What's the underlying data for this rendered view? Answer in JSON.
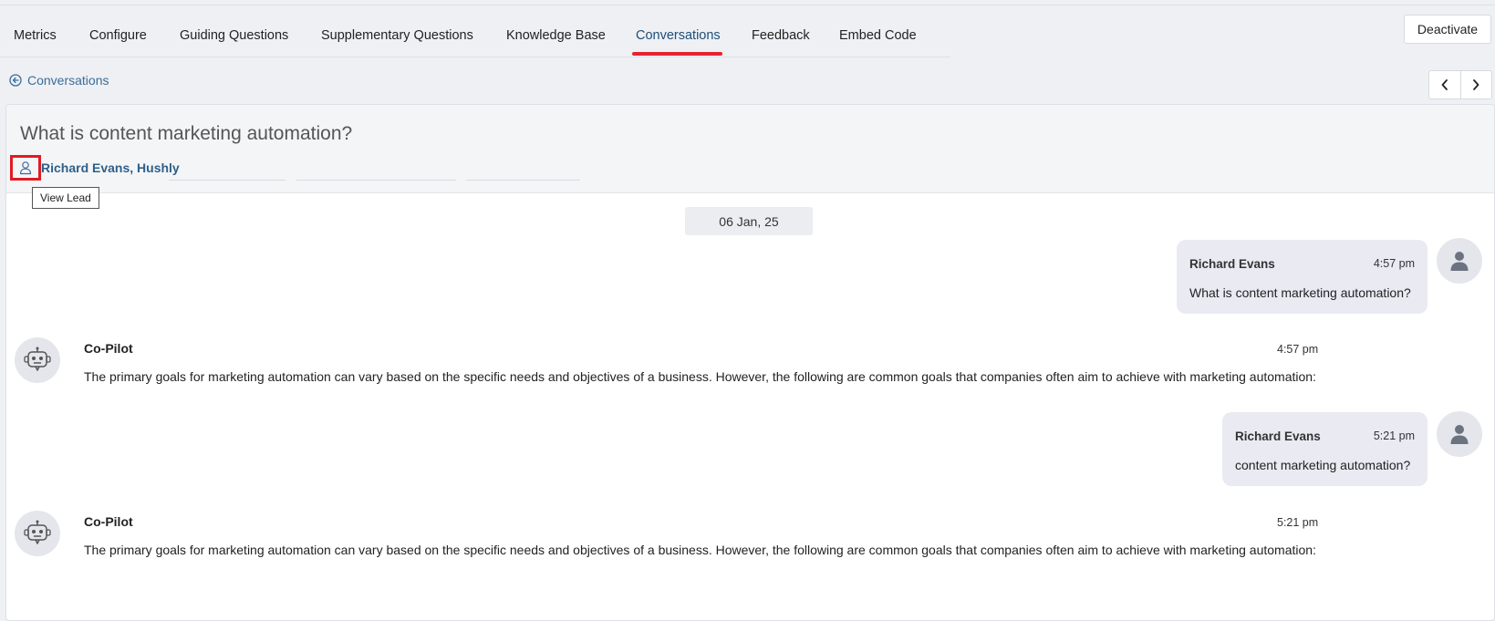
{
  "tabs": [
    {
      "label": "Metrics",
      "active": false
    },
    {
      "label": "Configure",
      "active": false
    },
    {
      "label": "Guiding Questions",
      "active": false
    },
    {
      "label": "Supplementary Questions",
      "active": false
    },
    {
      "label": "Knowledge Base",
      "active": false
    },
    {
      "label": "Conversations",
      "active": true
    },
    {
      "label": "Feedback",
      "active": false
    },
    {
      "label": "Embed Code",
      "active": false
    }
  ],
  "header": {
    "deactivate_label": "Deactivate"
  },
  "breadcrumb": {
    "back_label": "Conversations"
  },
  "conversation": {
    "title": "What is content marketing automation?",
    "lead_name": "Richard Evans, Hushly",
    "tooltip": "View Lead",
    "date": "06 Jan, 25"
  },
  "messages": [
    {
      "role": "user",
      "name": "Richard Evans",
      "time": "4:57 pm",
      "text": "What is content marketing automation?"
    },
    {
      "role": "bot",
      "name": "Co-Pilot",
      "time": "4:57 pm",
      "text": "The primary goals for marketing automation can vary based on the specific needs and objectives of a business. However, the following are common goals that companies often aim to achieve with marketing automation:"
    },
    {
      "role": "user",
      "name": "Richard Evans",
      "time": "5:21 pm",
      "text": "content marketing automation?"
    },
    {
      "role": "bot",
      "name": "Co-Pilot",
      "time": "5:21 pm",
      "text": "The primary goals for marketing automation can vary based on the specific needs and objectives of a business. However, the following are common goals that companies often aim to achieve with marketing automation:"
    }
  ],
  "colors": {
    "accent": "#e52330",
    "link": "#2f5f8a",
    "active_tab": "#1e4e79"
  }
}
